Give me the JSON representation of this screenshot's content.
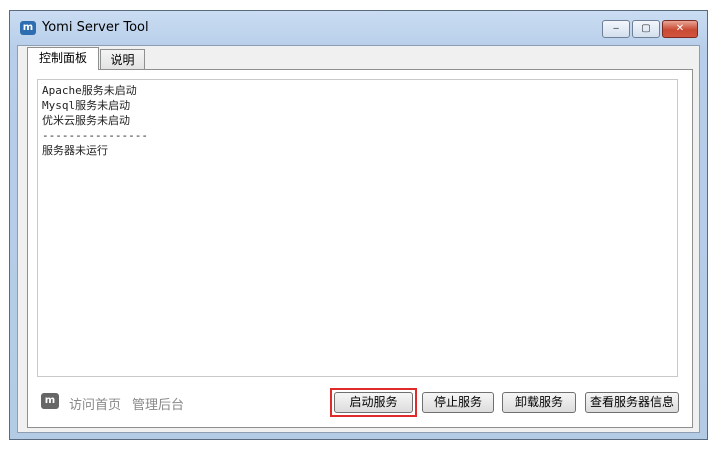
{
  "window": {
    "title": "Yomi Server Tool",
    "icon": "m",
    "controls": {
      "minimize": "‒",
      "maximize": "▢",
      "close": "✕"
    }
  },
  "tabs": [
    {
      "label": "控制面板",
      "active": true
    },
    {
      "label": "说明",
      "active": false
    }
  ],
  "log": {
    "lines": [
      "Apache服务未启动",
      "Mysql服务未启动",
      "优米云服务未启动",
      "----------------",
      "服务器未运行"
    ]
  },
  "footer": {
    "icon": "m",
    "links": {
      "home": "访问首页",
      "admin": "管理后台"
    },
    "buttons": {
      "start": "启动服务",
      "stop": "停止服务",
      "uninstall": "卸载服务",
      "info": "查看服务器信息"
    }
  },
  "colors": {
    "highlight": "#e02b2b",
    "titlebar": "#b7cde9"
  }
}
